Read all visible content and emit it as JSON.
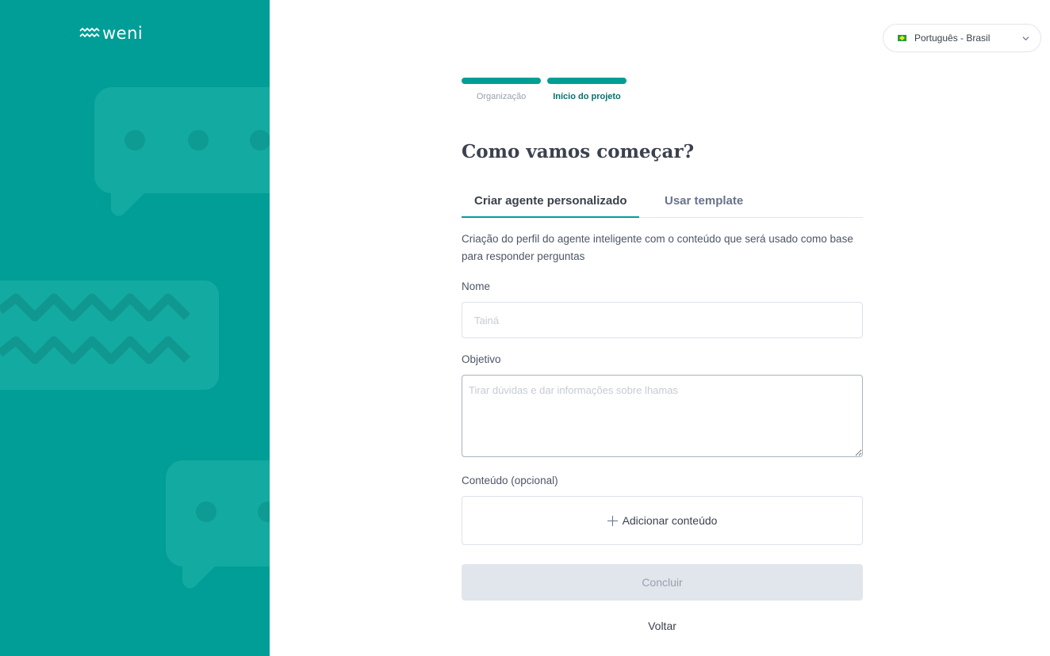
{
  "brand": {
    "name": "weni",
    "panel_color": "#009e96"
  },
  "language": {
    "flag_icon": "brazil-flag-icon",
    "label": "Português - Brasil"
  },
  "steps": [
    {
      "label": "Organização",
      "active": false
    },
    {
      "label": "Início do projeto",
      "active": true
    }
  ],
  "page": {
    "title": "Como vamos começar?"
  },
  "tabs": [
    {
      "label": "Criar agente personalizado",
      "active": true
    },
    {
      "label": "Usar template",
      "active": false
    }
  ],
  "form": {
    "description": "Criação do perfil do agente inteligente com o conteúdo que será usado como base para responder perguntas",
    "name": {
      "label": "Nome",
      "placeholder": "Tainá",
      "value": ""
    },
    "goal": {
      "label": "Objetivo",
      "placeholder": "Tirar dúvidas e dar informações sobre lhamas",
      "value": ""
    },
    "content": {
      "label": "Conteúdo (opcional)",
      "add_label": "Adicionar conteúdo"
    },
    "submit_label": "Concluir",
    "back_label": "Voltar"
  },
  "colors": {
    "accent": "#009e96",
    "disabled_bg": "#e1e5ec",
    "text": "#3b414d"
  }
}
